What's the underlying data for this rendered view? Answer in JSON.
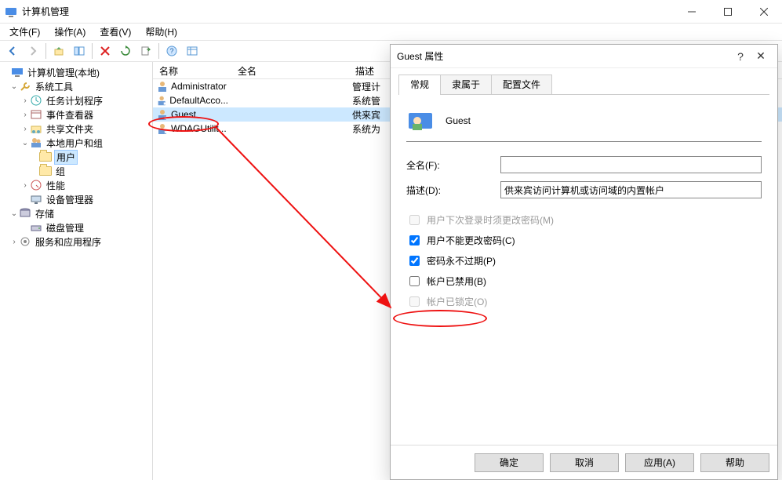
{
  "windowTitle": "计算机管理",
  "menu": {
    "file": "文件(F)",
    "action": "操作(A)",
    "view": "查看(V)",
    "help": "帮助(H)"
  },
  "tree": {
    "root": "计算机管理(本地)",
    "sysTools": "系统工具",
    "taskSched": "任务计划程序",
    "eventViewer": "事件查看器",
    "sharedFolders": "共享文件夹",
    "localUsers": "本地用户和组",
    "users": "用户",
    "groups": "组",
    "perf": "性能",
    "devMgr": "设备管理器",
    "storage": "存储",
    "diskMgmt": "磁盘管理",
    "services": "服务和应用程序"
  },
  "list": {
    "colName": "名称",
    "colFull": "全名",
    "colDesc": "描述",
    "rows": [
      {
        "name": "Administrator",
        "full": "",
        "desc": "管理计"
      },
      {
        "name": "DefaultAcco...",
        "full": "",
        "desc": "系统管"
      },
      {
        "name": "Guest",
        "full": "",
        "desc": "供来宾"
      },
      {
        "name": "WDAGUtilit...",
        "full": "",
        "desc": "系统为"
      }
    ]
  },
  "dialog": {
    "title": "Guest 属性",
    "tabs": {
      "general": "常规",
      "memberOf": "隶属于",
      "profile": "配置文件"
    },
    "userName": "Guest",
    "labels": {
      "fullName": "全名(F):",
      "description": "描述(D):"
    },
    "values": {
      "fullName": "",
      "description": "供来宾访问计算机或访问域的内置帐户"
    },
    "checks": {
      "mustChange": "用户下次登录时须更改密码(M)",
      "cannotChange": "用户不能更改密码(C)",
      "neverExpire": "密码永不过期(P)",
      "disabled": "帐户已禁用(B)",
      "locked": "帐户已锁定(O)"
    },
    "buttons": {
      "ok": "确定",
      "cancel": "取消",
      "apply": "应用(A)",
      "help": "帮助"
    }
  }
}
